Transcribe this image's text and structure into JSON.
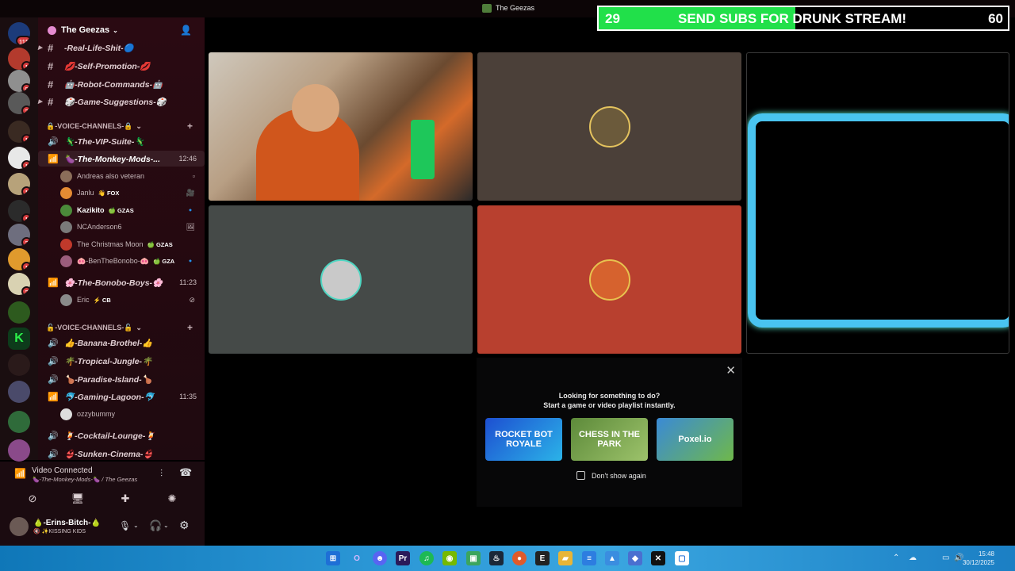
{
  "window": {
    "title": "The Geezas"
  },
  "banner": {
    "left_count": "29",
    "message": "SEND SUBS FOR DRUNK STREAM!",
    "right_count": "60",
    "progress": 0.48,
    "fill_color": "#21e04a"
  },
  "rail": {
    "badges": [
      "111",
      "1",
      "9",
      "3",
      "1",
      "1",
      "1",
      "1",
      "2",
      "1",
      "2"
    ]
  },
  "server": {
    "name": "The Geezas"
  },
  "text_channels": [
    {
      "label": "-Real-Life-Shit-🔵"
    },
    {
      "label": "💋-Self-Promotion-💋"
    },
    {
      "label": "🤖-Robot-Commands-🤖"
    },
    {
      "label": "🎲-Game-Suggestions-🎲"
    }
  ],
  "voice_categories": [
    {
      "label": "🔒-VOICE-CHANNELS-🔒"
    },
    {
      "label": "🔓-VOICE-CHANNELS-🔓"
    }
  ],
  "voice_channels_1": [
    {
      "label": "🦎-The-VIP-Suite-🦎",
      "time": ""
    },
    {
      "label": "🍆-The-Monkey-Mods-...",
      "time": "12:46"
    },
    {
      "label": "🌸-The-Bonobo-Boys-🌸",
      "time": "11:23"
    }
  ],
  "monkey_mods_users": [
    {
      "name": "Andreas also veteran",
      "tag": "",
      "color": "#8b6e5a"
    },
    {
      "name": "Janlu",
      "tag": "👋 FOX",
      "color": "#e58b33"
    },
    {
      "name": "Kazikito",
      "tag": "🍏 GZAS",
      "color": "#4b8a3a"
    },
    {
      "name": "NCAnderson6",
      "tag": "",
      "color": "#7a7a7a"
    },
    {
      "name": "The Christmas Moon",
      "tag": "🍏 GZAS",
      "color": "#c0392b"
    },
    {
      "name": "🐽-BenTheBonobo-🐽",
      "tag": "🍏 GZA",
      "color": "#9b5d7c"
    }
  ],
  "bonobo_users": [
    {
      "name": "Eric",
      "tag": "⚡ CB",
      "color": "#8a8a8a"
    }
  ],
  "voice_channels_2": [
    {
      "label": "👍-Banana-Brothel-👍",
      "time": ""
    },
    {
      "label": "🌴-Tropical-Jungle-🌴",
      "time": ""
    },
    {
      "label": "🍗-Paradise-Island-🍗",
      "time": ""
    },
    {
      "label": "🐬-Gaming-Lagoon-🐬",
      "time": "11:35"
    },
    {
      "label": "🍹-Cocktail-Lounge-🍹",
      "time": ""
    },
    {
      "label": "👙-Sunken-Cinema-👙",
      "time": ""
    }
  ],
  "lagoon_users": [
    {
      "name": "ozzybummy",
      "tag": "",
      "color": "#dddddd"
    }
  ],
  "voice_panel": {
    "status": "Video Connected",
    "location": "🍆-The-Monkey-Mods-🍆 / The Geezas"
  },
  "me": {
    "name": "🍐-Erins-Bitch-🍐",
    "status": "🔇 ✨KISSING KIDS"
  },
  "activity": {
    "line1": "Looking for something to do?",
    "line2": "Start a game or video playlist instantly.",
    "games": [
      "ROCKET BOT ROYALE",
      "CHESS IN THE PARK",
      "Poxel.io"
    ],
    "checkbox_label": "Don't show again"
  },
  "taskbar": {
    "time": "15:48",
    "date": "30/12/2025"
  }
}
